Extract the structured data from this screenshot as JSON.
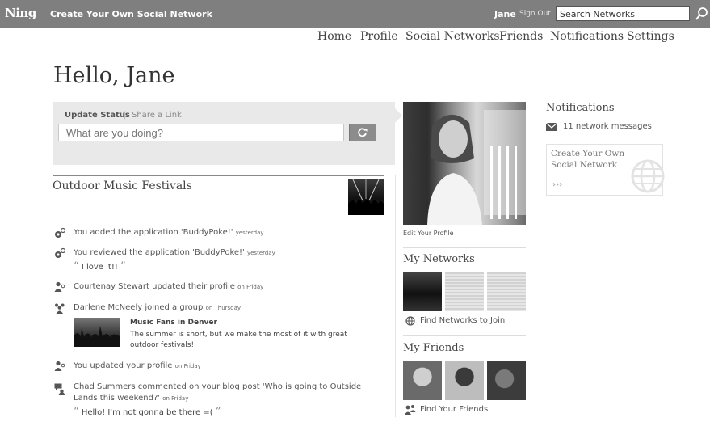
{
  "topbar": {
    "logo": "Ning",
    "tagline": "Create Your Own Social Network",
    "user": "Jane",
    "sign_out": "Sign Out",
    "search_value": "Search Networks"
  },
  "nav": {
    "items": [
      "Home",
      "Profile",
      "Social Networks",
      "Friends",
      "Notifications",
      "Settings"
    ]
  },
  "greeting": "Hello, Jane",
  "status": {
    "tab_update": "Update Status",
    "separator": "|",
    "tab_share": "Share a Link",
    "placeholder": "What are you doing?"
  },
  "feed": {
    "section_title": "Outdoor Music Festivals",
    "items": [
      {
        "text": "You added the application 'BuddyPoke!'",
        "time": "yesterday"
      },
      {
        "text": "You reviewed the application 'BuddyPoke!'",
        "time": "yesterday",
        "quote": "I love it!!"
      },
      {
        "text": "Courtenay Stewart updated their profile",
        "time": "on Friday"
      },
      {
        "text": "Darlene McNeely joined a group",
        "time": "on Thursday",
        "group_name": "Music Fans in Denver",
        "group_desc": "The summer is short, but we make the most of it with great outdoor festivals!"
      },
      {
        "text": "You updated your profile",
        "time": "on Friday"
      },
      {
        "text": "Chad Summers commented on your blog post 'Who is going to Outside",
        "text2": "Lands this weekend?'",
        "time": "on Friday",
        "quote": "Hello! I'm not gonna be there =("
      }
    ],
    "open_quote": "“",
    "close_quote": "”"
  },
  "profile": {
    "edit_label": "Edit Your Profile",
    "my_networks": "My Networks",
    "find_networks": "Find Networks to Join",
    "my_friends": "My Friends",
    "find_friends": "Find Your Friends"
  },
  "notifications": {
    "title": "Notifications",
    "messages": "11 network messages",
    "create_text": "Create Your Own Social Network",
    "create_arrow": "›››"
  }
}
